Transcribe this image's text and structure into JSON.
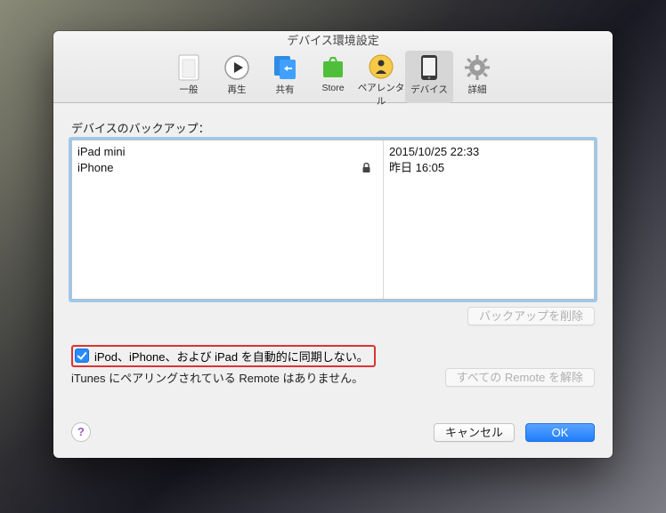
{
  "window_title": "デバイス環境設定",
  "toolbar": {
    "items": [
      {
        "label": "一般"
      },
      {
        "label": "再生"
      },
      {
        "label": "共有"
      },
      {
        "label": "Store"
      },
      {
        "label": "ペアレンタル"
      },
      {
        "label": "デバイス"
      },
      {
        "label": "詳細"
      }
    ],
    "selected_index": 5
  },
  "section_label": "デバイスのバックアップ：",
  "backups": [
    {
      "name": "iPad mini",
      "locked": false,
      "date": "2015/10/25 22:33"
    },
    {
      "name": "iPhone",
      "locked": true,
      "date": "昨日 16:05"
    }
  ],
  "delete_backup_label": "バックアップを削除",
  "prevent_sync_label": "iPod、iPhone、および iPad を自動的に同期しない。",
  "prevent_sync_checked": true,
  "remote_info": "iTunes にペアリングされている Remote はありません。",
  "forget_remotes_label": "すべての Remote を解除",
  "cancel_label": "キャンセル",
  "ok_label": "OK"
}
